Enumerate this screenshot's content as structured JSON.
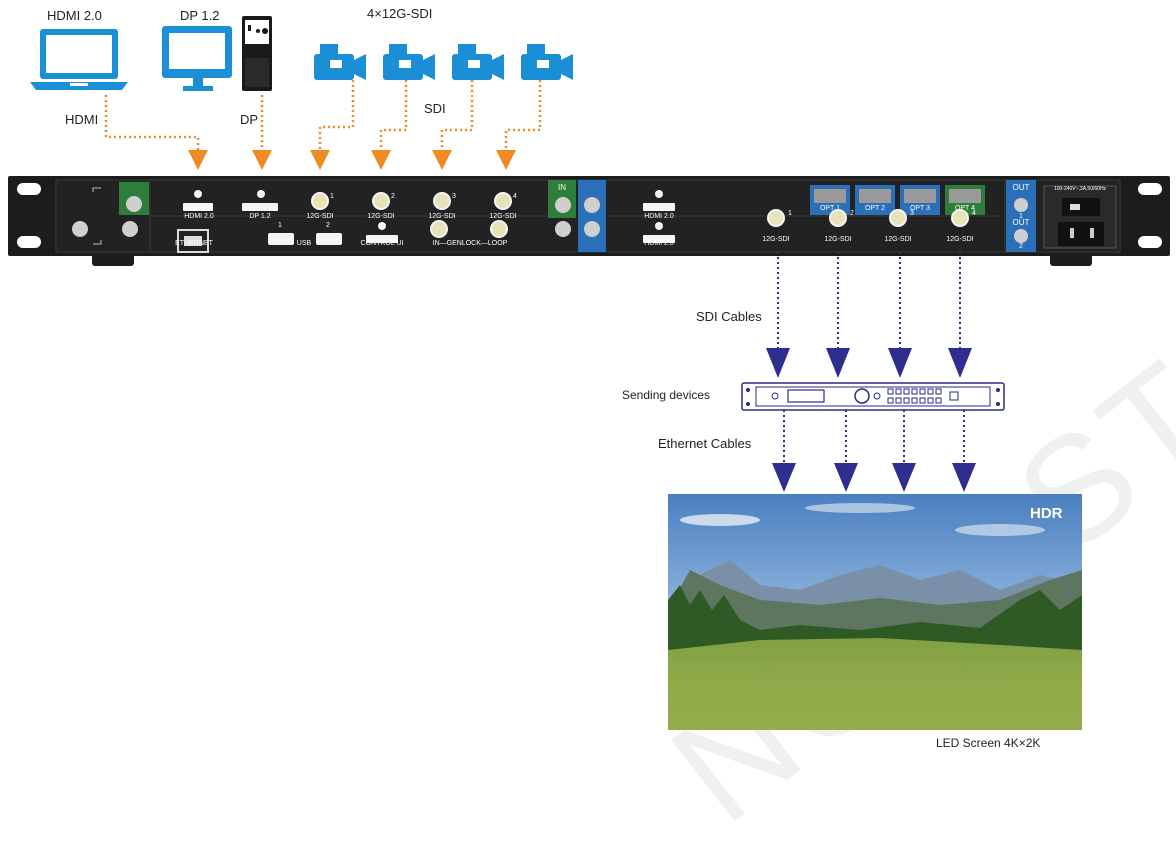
{
  "labels": {
    "hdmi20_top": "HDMI 2.0",
    "dp12_top": "DP 1.2",
    "sdi_count": "4×12G-SDI",
    "hdmi_cable": "HDMI",
    "dp_cable": "DP",
    "sdi_cable": "SDI",
    "sdi_cables": "SDI Cables",
    "sending_devices": "Sending devices",
    "ethernet_cables": "Ethernet Cables",
    "led_screen": "LED Screen   4K×2K",
    "hdr": "HDR"
  },
  "panel": {
    "top_ports": [
      "HDMI 2.0",
      "DP 1.2",
      "12G-SDI",
      "12G-SDI",
      "12G-SDI",
      "12G-SDI"
    ],
    "top_port_nums": [
      "1",
      "2",
      "3",
      "4"
    ],
    "bottom_ports": [
      "ETHERNET",
      "USB",
      "CONTROL UI",
      "IN—GENLOCK—LOOP"
    ],
    "usb_nums": [
      "1",
      "2"
    ],
    "in_label": "IN",
    "right_top_hdmi": "HDMI 2.0",
    "right_bottom_hdmi": "HDMI 2.0",
    "opt_ports": [
      "OPT 1",
      "OPT 2",
      "OPT 3",
      "OPT 4"
    ],
    "out_labels": [
      "OUT",
      "1",
      "OUT",
      "2"
    ],
    "out_sdi": [
      "12G-SDI",
      "12G-SDI",
      "12G-SDI",
      "12G-SDI"
    ],
    "out_sdi_nums": [
      "1",
      "2",
      "3",
      "4"
    ],
    "power_spec": "100-240V~,3A,50/60Hz"
  },
  "watermark": "NOVASTAR TECH CO., LTD.",
  "colors": {
    "orange_cable": "#f08a24",
    "blue_cable": "#2e2e8e",
    "device_blue": "#1a8fd6",
    "panel_dark": "#1c1c1c",
    "green_block": "#2e7d3a",
    "blue_block": "#2a6fb8"
  }
}
